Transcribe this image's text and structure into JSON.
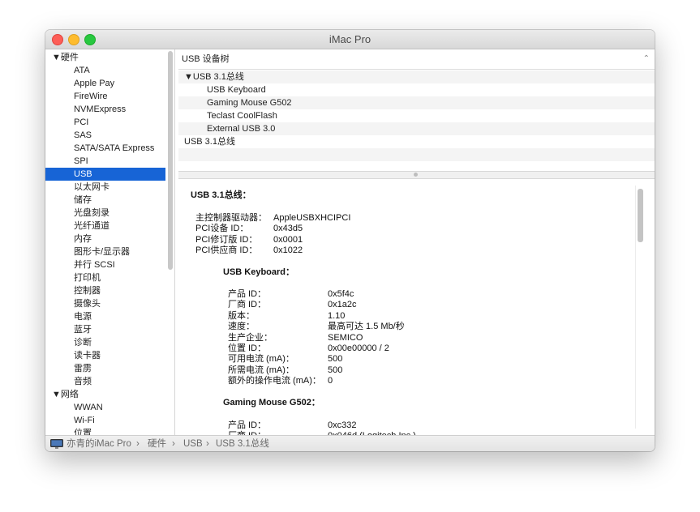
{
  "window": {
    "title": "iMac Pro"
  },
  "sidebar": {
    "rows": [
      {
        "label": "▼硬件",
        "kind": "cat"
      },
      {
        "label": "ATA",
        "kind": "item"
      },
      {
        "label": "Apple Pay",
        "kind": "item"
      },
      {
        "label": "FireWire",
        "kind": "item"
      },
      {
        "label": "NVMExpress",
        "kind": "item"
      },
      {
        "label": "PCI",
        "kind": "item"
      },
      {
        "label": "SAS",
        "kind": "item"
      },
      {
        "label": "SATA/SATA Express",
        "kind": "item"
      },
      {
        "label": "SPI",
        "kind": "item"
      },
      {
        "label": "USB",
        "kind": "item",
        "selected": true
      },
      {
        "label": "以太网卡",
        "kind": "item"
      },
      {
        "label": "储存",
        "kind": "item"
      },
      {
        "label": "光盘刻录",
        "kind": "item"
      },
      {
        "label": "光纤通道",
        "kind": "item"
      },
      {
        "label": "内存",
        "kind": "item"
      },
      {
        "label": "图形卡/显示器",
        "kind": "item"
      },
      {
        "label": "并行 SCSI",
        "kind": "item"
      },
      {
        "label": "打印机",
        "kind": "item"
      },
      {
        "label": "控制器",
        "kind": "item"
      },
      {
        "label": "摄像头",
        "kind": "item"
      },
      {
        "label": "电源",
        "kind": "item"
      },
      {
        "label": "蓝牙",
        "kind": "item"
      },
      {
        "label": "诊断",
        "kind": "item"
      },
      {
        "label": "读卡器",
        "kind": "item"
      },
      {
        "label": "雷雳",
        "kind": "item"
      },
      {
        "label": "音频",
        "kind": "item"
      },
      {
        "label": "▼网络",
        "kind": "cat"
      },
      {
        "label": "WWAN",
        "kind": "item"
      },
      {
        "label": "Wi-Fi",
        "kind": "item"
      },
      {
        "label": "位置",
        "kind": "item"
      }
    ]
  },
  "tree": {
    "header": "USB 设备树",
    "chevron": "⌃",
    "rows": [
      {
        "label": "▼USB 3.1总线",
        "indent": 1,
        "alt": true
      },
      {
        "label": "USB Keyboard",
        "indent": 2,
        "alt": false
      },
      {
        "label": "Gaming Mouse G502",
        "indent": 2,
        "alt": true
      },
      {
        "label": "Teclast CoolFlash",
        "indent": 2,
        "alt": false
      },
      {
        "label": "External USB 3.0",
        "indent": 2,
        "alt": true
      },
      {
        "label": "USB 3.1总线",
        "indent": 1,
        "alt": false
      },
      {
        "label": "",
        "indent": 1,
        "alt": true
      },
      {
        "label": "",
        "indent": 1,
        "alt": false
      }
    ]
  },
  "detail": {
    "heading": "USB 3.1总线：",
    "bus_props": [
      {
        "key": "主控制器驱动器：",
        "value": "AppleUSBXHCIPCI"
      },
      {
        "key": "PCI设备 ID：",
        "value": "0x43d5"
      },
      {
        "key": "PCI修订版 ID：",
        "value": "0x0001"
      },
      {
        "key": "PCI供应商 ID：",
        "value": "0x1022"
      }
    ],
    "device1": {
      "name": "USB Keyboard：",
      "props": [
        {
          "key": "产品 ID：",
          "value": "0x5f4c"
        },
        {
          "key": "厂商 ID：",
          "value": "0x1a2c"
        },
        {
          "key": "版本：",
          "value": "1.10"
        },
        {
          "key": "速度：",
          "value": "最高可达 1.5 Mb/秒"
        },
        {
          "key": "生产企业：",
          "value": "SEMICO"
        },
        {
          "key": "位置 ID：",
          "value": "0x00e00000 / 2"
        },
        {
          "key": "可用电流 (mA)：",
          "value": "500"
        },
        {
          "key": "所需电流 (mA)：",
          "value": "500"
        },
        {
          "key": "额外的操作电流 (mA)：",
          "value": "0"
        }
      ]
    },
    "device2": {
      "name": "Gaming Mouse G502：",
      "props": [
        {
          "key": "产品 ID：",
          "value": "0xc332"
        },
        {
          "key": "厂商 ID：",
          "value": "0x046d  (Logitech Inc.)"
        }
      ]
    }
  },
  "statusbar": {
    "crumbs": [
      "亦青的iMac Pro",
      "›",
      "硬件",
      "›",
      "USB",
      "›",
      "USB 3.1总线"
    ]
  }
}
